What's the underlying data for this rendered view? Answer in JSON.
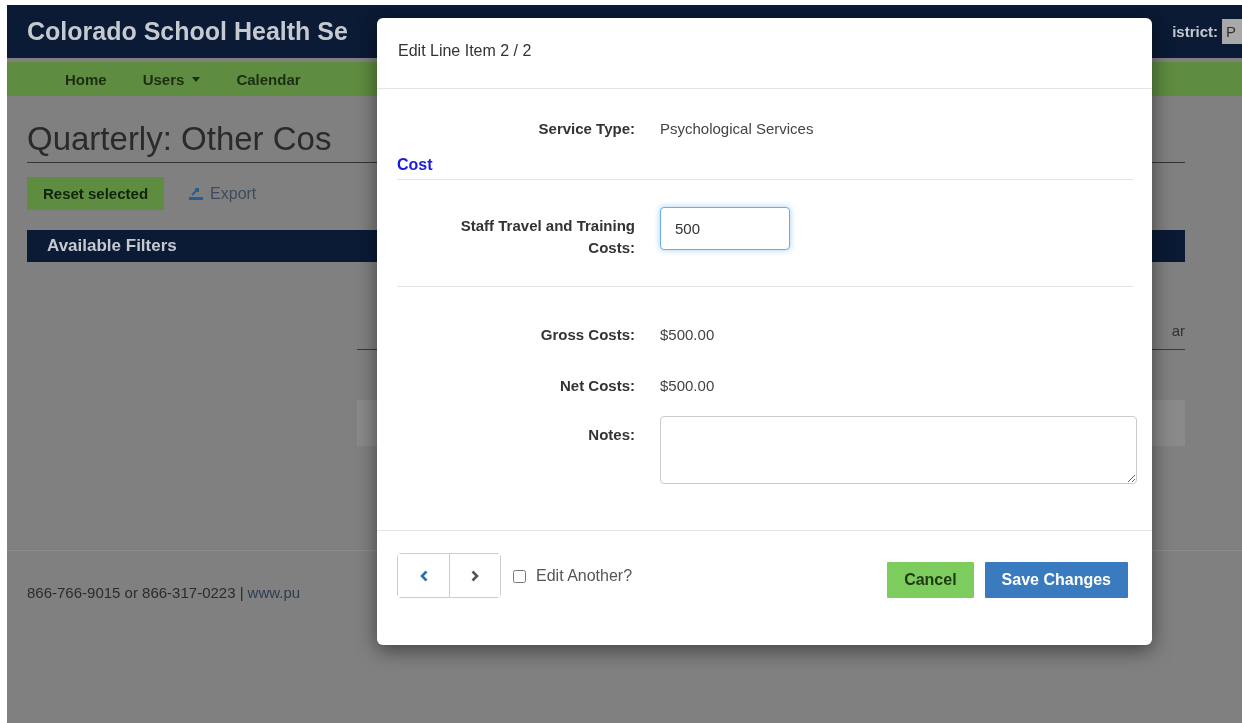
{
  "header": {
    "title": "Colorado School Health Se",
    "district_label": "istrict:",
    "district_value": "P"
  },
  "nav": [
    {
      "label": "Home",
      "dropdown": false
    },
    {
      "label": "Users",
      "dropdown": true
    },
    {
      "label": "Calendar",
      "dropdown": false
    }
  ],
  "page": {
    "title": "Quarterly: Other Cos",
    "reset_button": "Reset selected",
    "export_link": "Export",
    "filters_title": "Available Filters",
    "column_text": "ar"
  },
  "footer": {
    "phones": "866-766-9015 or 866-317-0223 |",
    "link": "www.pu"
  },
  "modal": {
    "title": "Edit Line Item 2 / 2",
    "service_type": {
      "label": "Service Type:",
      "value": "Psychological Services"
    },
    "section": "Cost",
    "cost_fields": [
      {
        "label": "Staff Travel and Training Costs:",
        "kind": "input",
        "value": "500",
        "focused": true
      }
    ],
    "totals": [
      {
        "label": "Gross Costs:",
        "kind": "static",
        "value": "$500.00"
      },
      {
        "label": "Net Costs:",
        "kind": "static",
        "value": "$500.00"
      },
      {
        "label": "Notes:",
        "kind": "textarea"
      }
    ],
    "edit_another": {
      "label": "Edit Another?",
      "checked": false
    },
    "buttons": [
      {
        "label": "Cancel",
        "kind": "cancel"
      },
      {
        "label": "Save Changes",
        "kind": "primary"
      }
    ]
  }
}
